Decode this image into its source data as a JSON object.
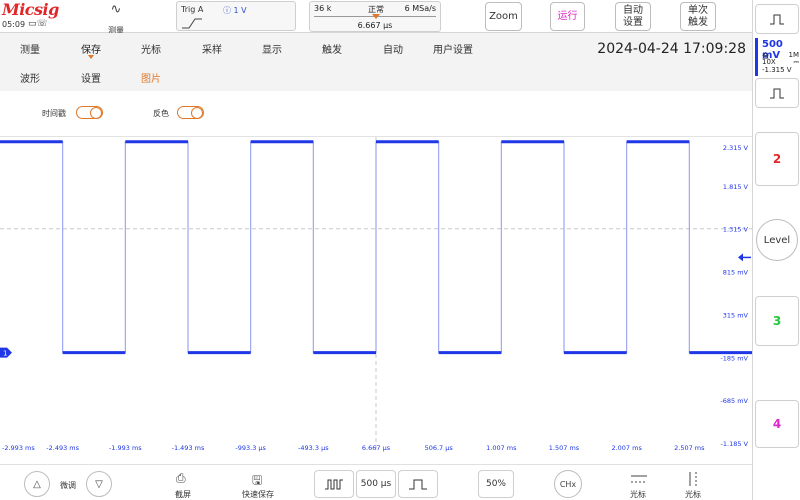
{
  "brand": {
    "logo": "Micsig",
    "time": "05:09",
    "status_icons": "▭☏"
  },
  "toolbar": {
    "measure_label": "测量",
    "trigger": {
      "label": "Trig A",
      "level": "ⓘ 1 V"
    },
    "acquisition": {
      "points": "36 k",
      "mode": "正常",
      "rate": "6 MSa/s",
      "position": "6.667 μs"
    },
    "zoom_label": "Zoom",
    "run_label": "运行",
    "auto_label_1": "自动",
    "auto_label_2": "设置",
    "single_label_1": "单次",
    "single_label_2": "触发"
  },
  "menu": {
    "row1": [
      "测量",
      "保存",
      "光标",
      "采样",
      "显示",
      "触发",
      "自动",
      "用户设置"
    ],
    "row2": [
      "波形",
      "设置",
      "图片"
    ],
    "datetime": "2024-04-24 17:09:28"
  },
  "options": {
    "timestamp_label": "时间戳",
    "invert_label": "反色"
  },
  "channel1": {
    "scale": "500 mV",
    "coupling": "全",
    "impedance": "1M",
    "probe": "10X",
    "coupling_symbol": "⎓",
    "offset": "-1.315 V",
    "marker": "1"
  },
  "right_panel": {
    "ch2": "2",
    "ch3": "3",
    "ch4": "4",
    "level_label": "Level"
  },
  "chart_data": {
    "type": "line",
    "title": "",
    "xlabel": "",
    "ylabel": "",
    "x_ticks": [
      "-2.993 ms",
      "-2.493 ms",
      "-1.993 ms",
      "-1.493 ms",
      "-993.3 μs",
      "-493.3 μs",
      "6.667 μs",
      "506.7 μs",
      "1.007 ms",
      "1.507 ms",
      "2.007 ms",
      "2.507 ms"
    ],
    "y_ticks": [
      "2.315 V",
      "1.815 V",
      "1.315 V",
      "815 mV",
      "315 mV",
      "-185 mV",
      "-685 mV",
      "-1.185 V"
    ],
    "xlim_ms": [
      -2.993,
      3.007
    ],
    "ylim_v": [
      -1.185,
      2.315
    ],
    "series": [
      {
        "color": "#1f37e6",
        "high_v": 2.33,
        "low_v": -0.13,
        "period_ms": 1.0,
        "first_rise_ms": -2.493,
        "duty": 0.5,
        "x_ms": [
          -2.993,
          -2.493,
          -2.493,
          -1.993,
          -1.993,
          -1.493,
          -1.493,
          -0.993,
          -0.993,
          -0.493,
          -0.493,
          0.007,
          0.007,
          0.507,
          0.507,
          1.007,
          1.007,
          1.507,
          1.507,
          2.007,
          2.007,
          2.507,
          2.507,
          3.007
        ],
        "y_v": [
          2.33,
          2.33,
          -0.13,
          -0.13,
          2.33,
          2.33,
          -0.13,
          -0.13,
          2.33,
          2.33,
          -0.13,
          -0.13,
          2.33,
          2.33,
          -0.13,
          -0.13,
          2.33,
          2.33,
          -0.13,
          -0.13,
          2.33,
          2.33,
          -0.13,
          -0.13
        ]
      }
    ],
    "grid": "dashed center crosshair"
  },
  "bottom": {
    "fine_label": "微调",
    "screenshot_label": "截屏",
    "quicksave_label": "快速保存",
    "timebase": "500 μs",
    "percent": "50%",
    "chx": "CHx",
    "cursor1_label": "光标",
    "cursor2_label": "光标"
  }
}
